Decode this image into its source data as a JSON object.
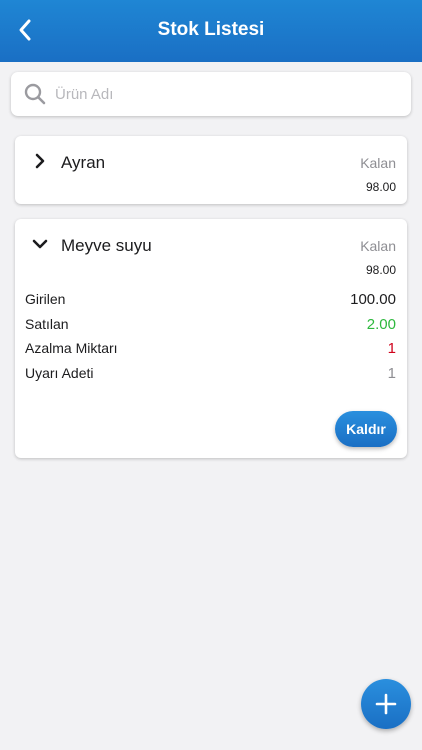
{
  "header": {
    "title": "Stok Listesi",
    "back_icon": "chevron-left-icon",
    "background_color": "#1a6fc4"
  },
  "search": {
    "placeholder": "Ürün Adı",
    "value": "",
    "icon": "search-icon"
  },
  "items": [
    {
      "name": "Ayran",
      "expanded": false,
      "remaining_label": "Kalan",
      "remaining_value": "98.00"
    },
    {
      "name": "Meyve suyu",
      "expanded": true,
      "remaining_label": "Kalan",
      "remaining_value": "98.00",
      "details": [
        {
          "label": "Girilen",
          "value": "100.00",
          "color": "#1c1c1e"
        },
        {
          "label": "Satılan",
          "value": "2.00",
          "color": "#2db83d"
        },
        {
          "label": "Azalma Miktarı",
          "value": "1",
          "color": "#d0021b"
        },
        {
          "label": "Uyarı Adeti",
          "value": "1",
          "color": "#8e8e93"
        }
      ],
      "action_label": "Kaldır"
    }
  ],
  "fab": {
    "icon": "plus-icon"
  },
  "colors": {
    "accent": "#1f86d4",
    "positive": "#2db83d",
    "negative": "#d0021b"
  }
}
